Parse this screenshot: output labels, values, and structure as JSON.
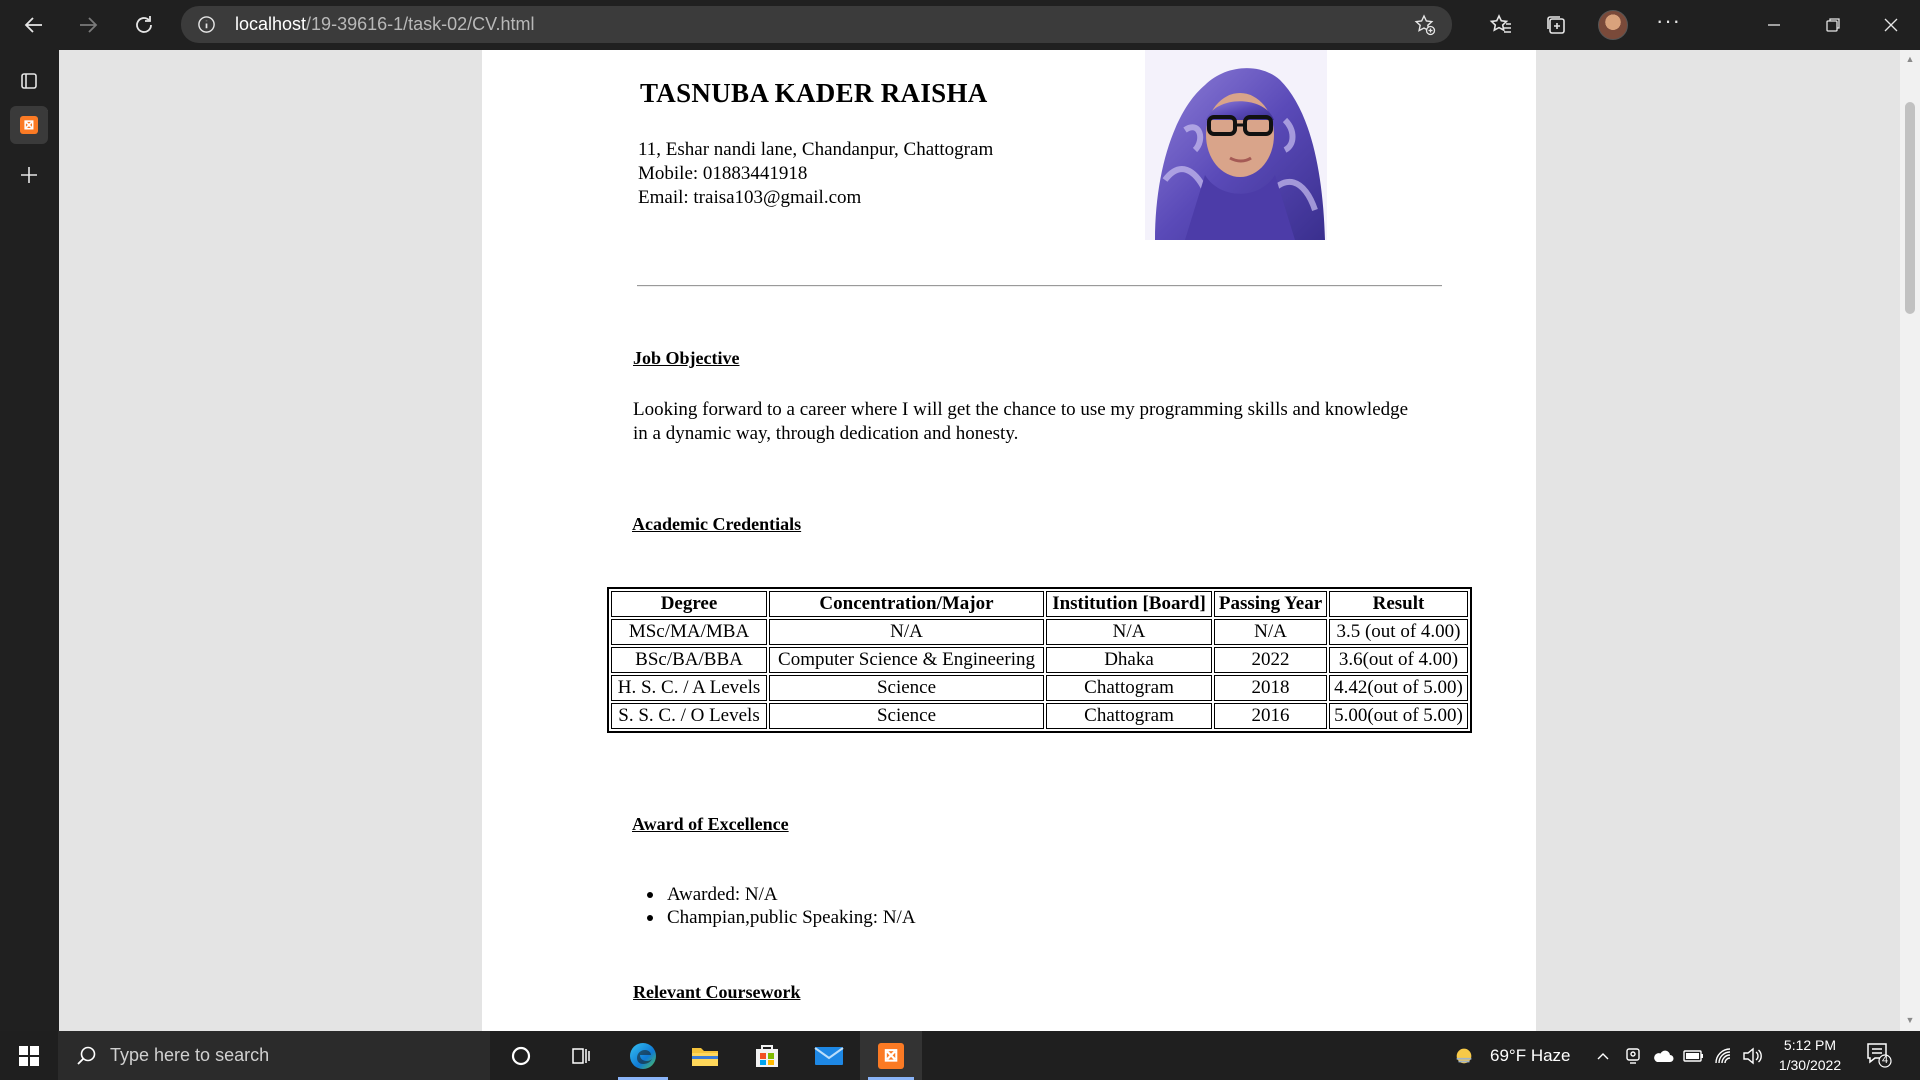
{
  "browser": {
    "url_host": "localhost",
    "url_path": "/19-39616-1/task-02/CV.html"
  },
  "cv": {
    "name": "TASNUBA KADER RAISHA",
    "address": "11, Eshar nandi lane, Chandanpur, Chattogram",
    "mobile": "Mobile: 01883441918",
    "email": "Email: traisa103@gmail.com",
    "job_objective": {
      "heading": "Job Objective",
      "text": "Looking forward to a career where I will get the chance to use my programming skills and knowledge in a dynamic way, through dedication and honesty."
    },
    "academic": {
      "heading": "Academic Credentials",
      "columns": [
        "Degree",
        "Concentration/Major",
        "Institution [Board]",
        "Passing Year",
        "Result"
      ],
      "rows": [
        [
          "MSc/MA/MBA",
          "N/A",
          "N/A",
          "N/A",
          "3.5 (out of 4.00)"
        ],
        [
          "BSc/BA/BBA",
          "Computer Science & Engineering",
          "Dhaka",
          "2022",
          "3.6(out of 4.00)"
        ],
        [
          "H. S. C. / A Levels",
          "Science",
          "Chattogram",
          "2018",
          "4.42(out of 5.00)"
        ],
        [
          "S. S. C. / O Levels",
          "Science",
          "Chattogram",
          "2016",
          "5.00(out of 5.00)"
        ]
      ]
    },
    "awards": {
      "heading": "Award of Excellence",
      "items": [
        "Awarded: N/A",
        "Champian,public Speaking: N/A"
      ]
    },
    "coursework": {
      "heading": "Relevant Coursework"
    }
  },
  "taskbar": {
    "search_placeholder": "Type here to search",
    "weather": "69°F  Haze",
    "time": "5:12 PM",
    "date": "1/30/2022",
    "notification_count": "4"
  },
  "colors": {
    "accent": "#8ab4f8",
    "xampp": "#fb7a24"
  }
}
